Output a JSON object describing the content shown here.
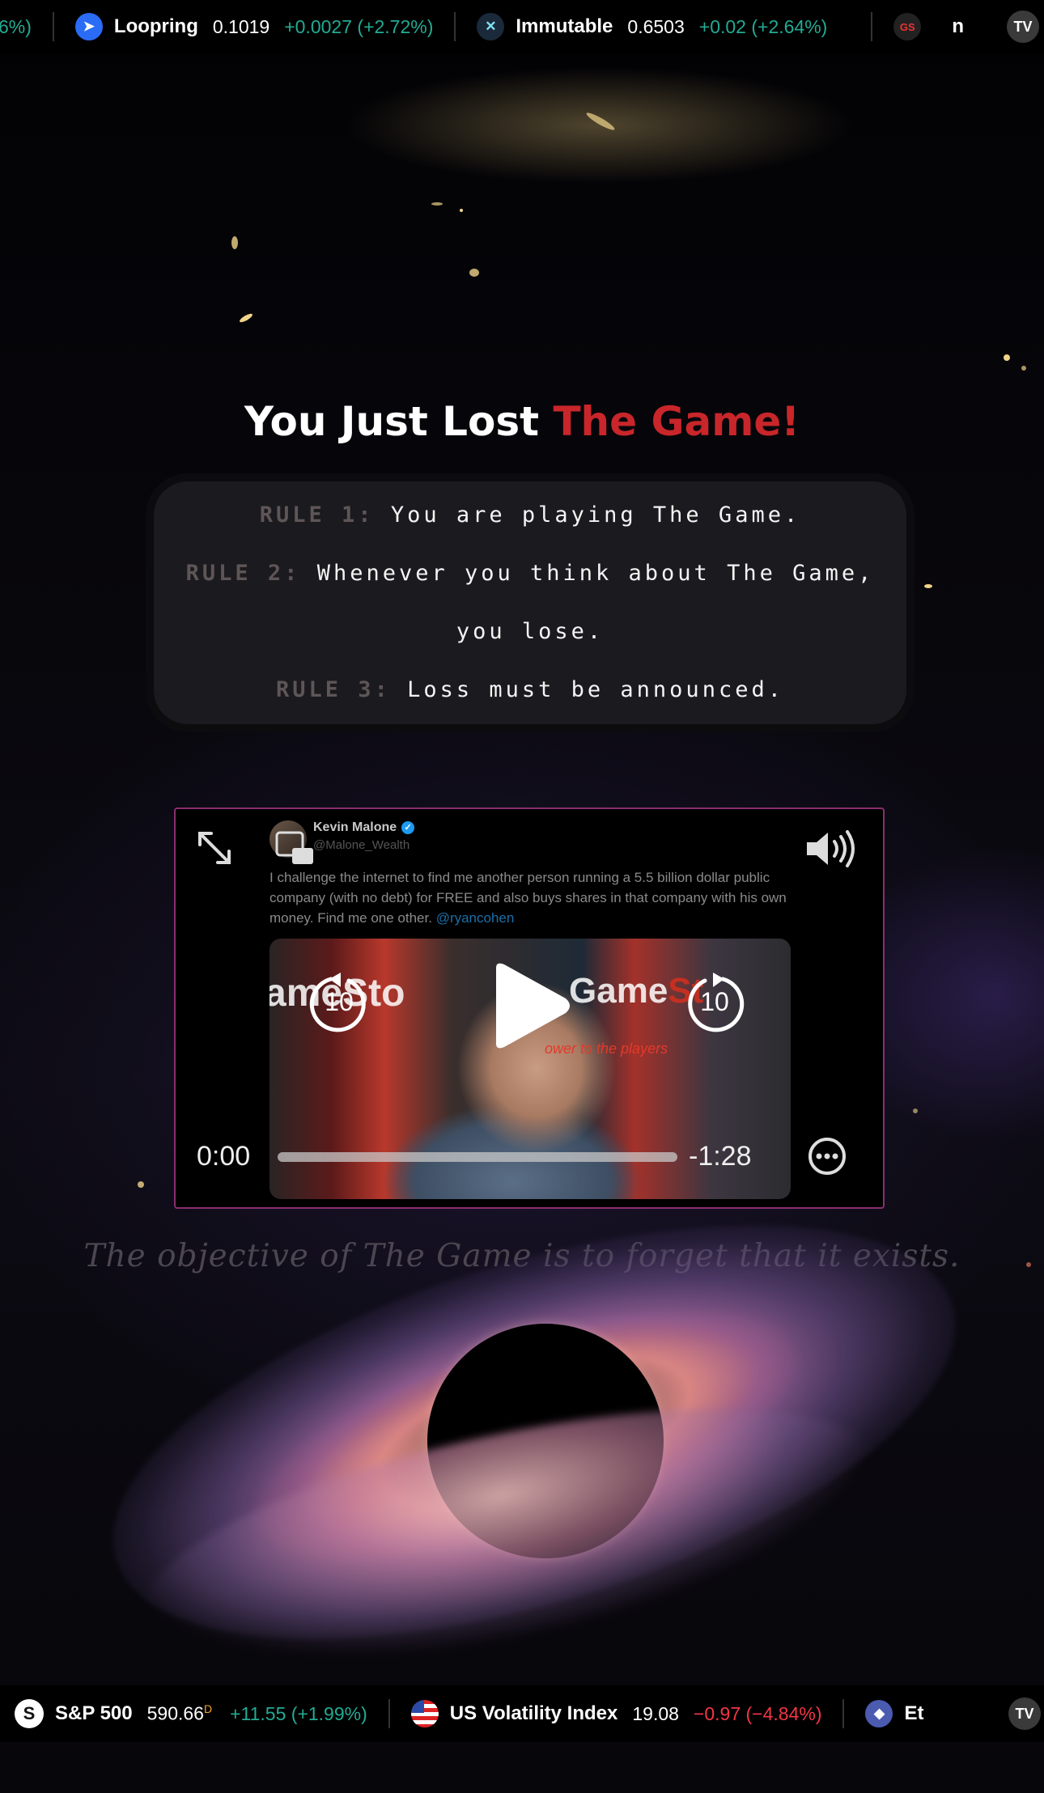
{
  "top_ticker": {
    "lead_fragment": "6%)",
    "items": [
      {
        "name": "Loopring",
        "price": "0.1019",
        "change": "+0.0027 (+2.72%)",
        "direction": "up",
        "logo_color": "#2a6cf6",
        "icon": "loopring-icon"
      },
      {
        "name": "Immutable",
        "price": "0.6503",
        "change": "+0.02 (+2.64%)",
        "direction": "up",
        "logo_color": "#1b2a3a",
        "icon": "immutable-icon"
      }
    ],
    "trailing_logo": "GS",
    "trailing_fragment": "n",
    "badge": "TV"
  },
  "heading": {
    "prefix": "You Just Lost ",
    "accent": "The Game!"
  },
  "rules": [
    {
      "label": "RULE 1:",
      "text": "You are playing The Game."
    },
    {
      "label": "RULE 2:",
      "text": "Whenever you think about The Game, you lose."
    },
    {
      "label": "RULE 3:",
      "text": "Loss must be announced."
    }
  ],
  "video": {
    "tweet_author": "Kevin Malone",
    "tweet_handle": "@Malone_Wealth",
    "tweet_text": "I challenge the internet to find me another person running a 5.5 billion dollar public company (with no debt) for FREE and also buys shares in that company with his own money. Find me one other. ",
    "tweet_mention": "@ryancohen",
    "sign_left": "ameSto",
    "sign_right_main": "Game",
    "sign_right_red": "St",
    "sign_tagline": "ower to the players",
    "skip_back": "10",
    "skip_forward": "10",
    "current_time": "0:00",
    "remaining_time": "-1:28",
    "progress": 0
  },
  "tagline": "The objective of The Game is to forget that it exists.",
  "bottom_ticker": {
    "items": [
      {
        "name": "S&P 500",
        "price": "590.66",
        "price_suffix": "D",
        "change": "+11.55 (+1.99%)",
        "direction": "up",
        "logo_text": "S",
        "icon": "sp500-icon"
      },
      {
        "name": "US Volatility Index",
        "price": "19.08",
        "change": "−0.97 (−4.84%)",
        "direction": "down",
        "icon": "us-flag-icon"
      }
    ],
    "trailing_fragment": "Et",
    "badge": "TV"
  },
  "colors": {
    "accent_red": "#c8262a",
    "up_green": "#22ab94",
    "down_red": "#f23645",
    "video_border": "#8a2e6e"
  }
}
